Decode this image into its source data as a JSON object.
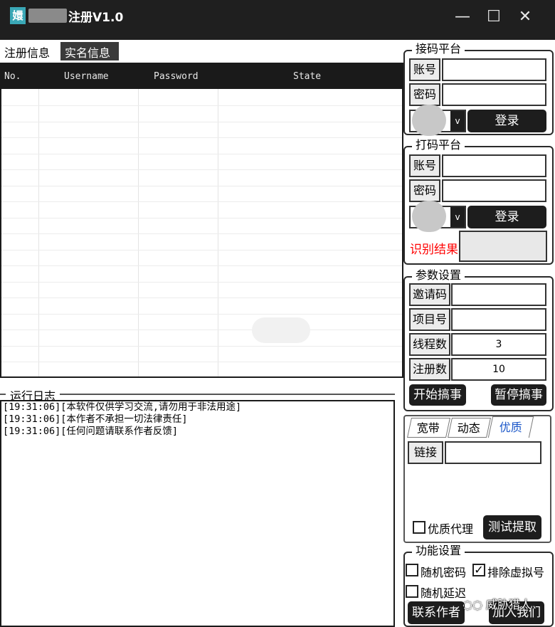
{
  "window": {
    "title": "注册V1.0",
    "logo_glyph": "嬛",
    "controls": {
      "minimize": "—",
      "maximize": "☐",
      "close": "✕"
    }
  },
  "tabs": [
    {
      "label": "注册信息"
    },
    {
      "label": "实名信息"
    }
  ],
  "grid": {
    "columns": [
      "No.",
      "Username",
      "Password",
      "State"
    ],
    "rows": []
  },
  "sms_platform": {
    "title": "接码平台",
    "account_label": "账号",
    "password_label": "密码",
    "login_label": "登录",
    "select_arrow": "v"
  },
  "captcha_platform": {
    "title": "打码平台",
    "account_label": "账号",
    "password_label": "密码",
    "login_label": "登录",
    "select_arrow": "v",
    "result_label": "识别结果",
    "result_color": "#ff0000"
  },
  "params": {
    "title": "参数设置",
    "invite_label": "邀请码",
    "project_label": "项目号",
    "threads_label": "线程数",
    "threads_value": "3",
    "register_count_label": "注册数",
    "register_count_value": "10",
    "start_label": "开始搞事",
    "pause_label": "暂停搞事"
  },
  "proxy": {
    "tabs": [
      {
        "label": "宽带"
      },
      {
        "label": "动态"
      },
      {
        "label": "优质"
      }
    ],
    "active_tab_color": "#1a56c8",
    "link_label": "链接",
    "quality_proxy_label": "优质代理",
    "test_fetch_label": "测试提取"
  },
  "features": {
    "title": "功能设置",
    "random_password_label": "随机密码",
    "random_password_checked": false,
    "exclude_virtual_label": "排除虚拟号",
    "exclude_virtual_checked": true,
    "random_delay_label": "随机延迟",
    "random_delay_checked": false,
    "contact_label": "联系作者",
    "join_label": "加入我们"
  },
  "log": {
    "title": "运行日志",
    "lines": [
      "[19:31:06][本软件仅供学习交流,请勿用于非法用途]",
      "[19:31:06][本作者不承担一切法律责任]",
      "[19:31:06][任何问题请联系作者反馈]"
    ]
  },
  "watermark": {
    "text": "威胁猎人"
  }
}
